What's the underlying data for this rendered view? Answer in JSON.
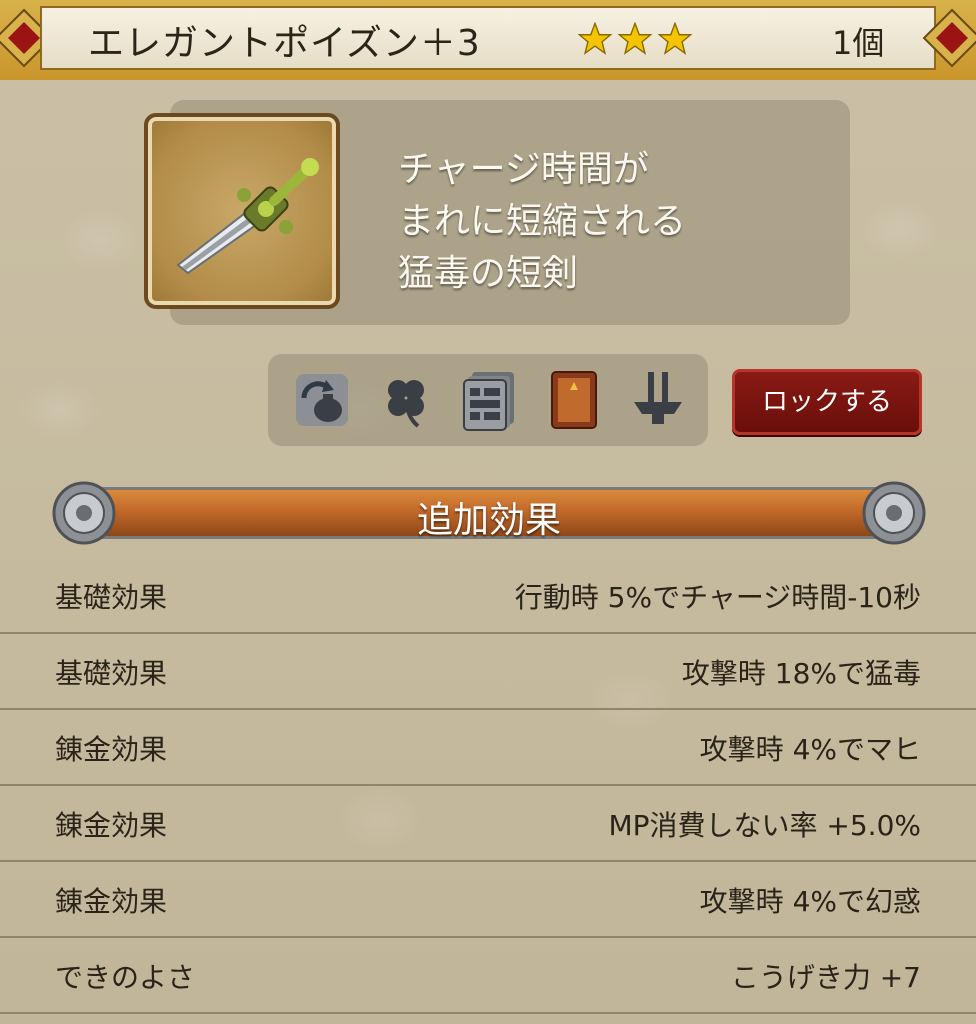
{
  "item": {
    "name": "エレガントポイズン＋3",
    "rarity_stars": 3,
    "count": "1個",
    "description": [
      "チャージ時間が",
      "まれに短縮される",
      "猛毒の短剣"
    ]
  },
  "icons": [
    "sell-bag-icon",
    "clover-icon",
    "card-stack-icon",
    "book-icon",
    "fork-anvil-icon"
  ],
  "lock_button": "ロックする",
  "section": {
    "title": "追加効果"
  },
  "effects": [
    {
      "label": "基礎効果",
      "value": "行動時  5%でチャージ時間-10秒"
    },
    {
      "label": "基礎効果",
      "value": "攻撃時  18%で猛毒"
    },
    {
      "label": "錬金効果",
      "value": "攻撃時  4%でマヒ"
    },
    {
      "label": "錬金効果",
      "value": "MP消費しない率  +5.0%"
    },
    {
      "label": "錬金効果",
      "value": "攻撃時  4%で幻惑"
    },
    {
      "label": "できのよさ",
      "value": "こうげき力  +7"
    }
  ],
  "colors": {
    "header_gold": "#d8b24a",
    "lock_red": "#8a1a14",
    "banner_orange": "#c2692a",
    "star_yellow": "#f5c400"
  }
}
